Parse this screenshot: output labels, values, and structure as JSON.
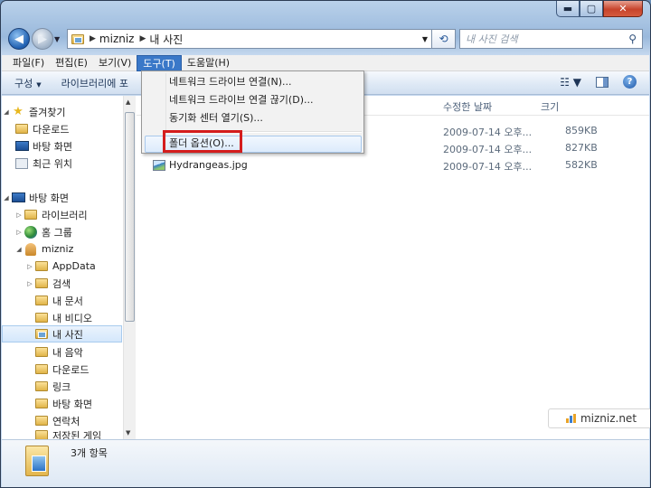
{
  "window": {
    "min_label": "▬",
    "max_label": "▢",
    "close_label": "✕"
  },
  "address": {
    "crumbs": [
      "mizniz",
      "내 사진"
    ],
    "search_placeholder": "내 사진 검색"
  },
  "menubar": {
    "items": [
      "파일(F)",
      "편집(E)",
      "보기(V)",
      "도구(T)",
      "도움말(H)"
    ],
    "active_index": 3
  },
  "commandbar": {
    "organize": "구성",
    "library": "라이브러리에 포"
  },
  "dropdown": {
    "items": [
      "네트워크 드라이브 연결(N)...",
      "네트워크 드라이브 연결 끊기(D)...",
      "동기화 센터 열기(S)...",
      "폴더 옵션(O)..."
    ],
    "highlight_index": 3
  },
  "nav": {
    "favorites": "즐겨찾기",
    "downloads": "다운로드",
    "desktop_fav": "바탕 화면",
    "recent": "최근 위치",
    "desktop": "바탕 화면",
    "libraries": "라이브러리",
    "homegroup": "홈 그룹",
    "user": "mizniz",
    "appdata": "AppData",
    "searches": "검색",
    "documents": "내 문서",
    "videos": "내 비디오",
    "pictures": "내 사진",
    "music": "내 음악",
    "downloads2": "다운로드",
    "links": "링크",
    "desktop2": "바탕 화면",
    "contacts": "연락처",
    "saved_games": "저장된 게임"
  },
  "columns": {
    "date": "수정한 날짜",
    "size": "크기"
  },
  "files": [
    {
      "name": "",
      "date": "2009-07-14 오후...",
      "size": "859KB"
    },
    {
      "name": "",
      "date": "2009-07-14 오후...",
      "size": "827KB"
    },
    {
      "name": "Hydrangeas.jpg",
      "date": "2009-07-14 오후...",
      "size": "582KB"
    }
  ],
  "watermark": "mizniz.net",
  "status": {
    "count": "3개 항목"
  },
  "colors": {
    "menu_active": "#3a78c8",
    "highlight_box": "#d41d1d"
  }
}
